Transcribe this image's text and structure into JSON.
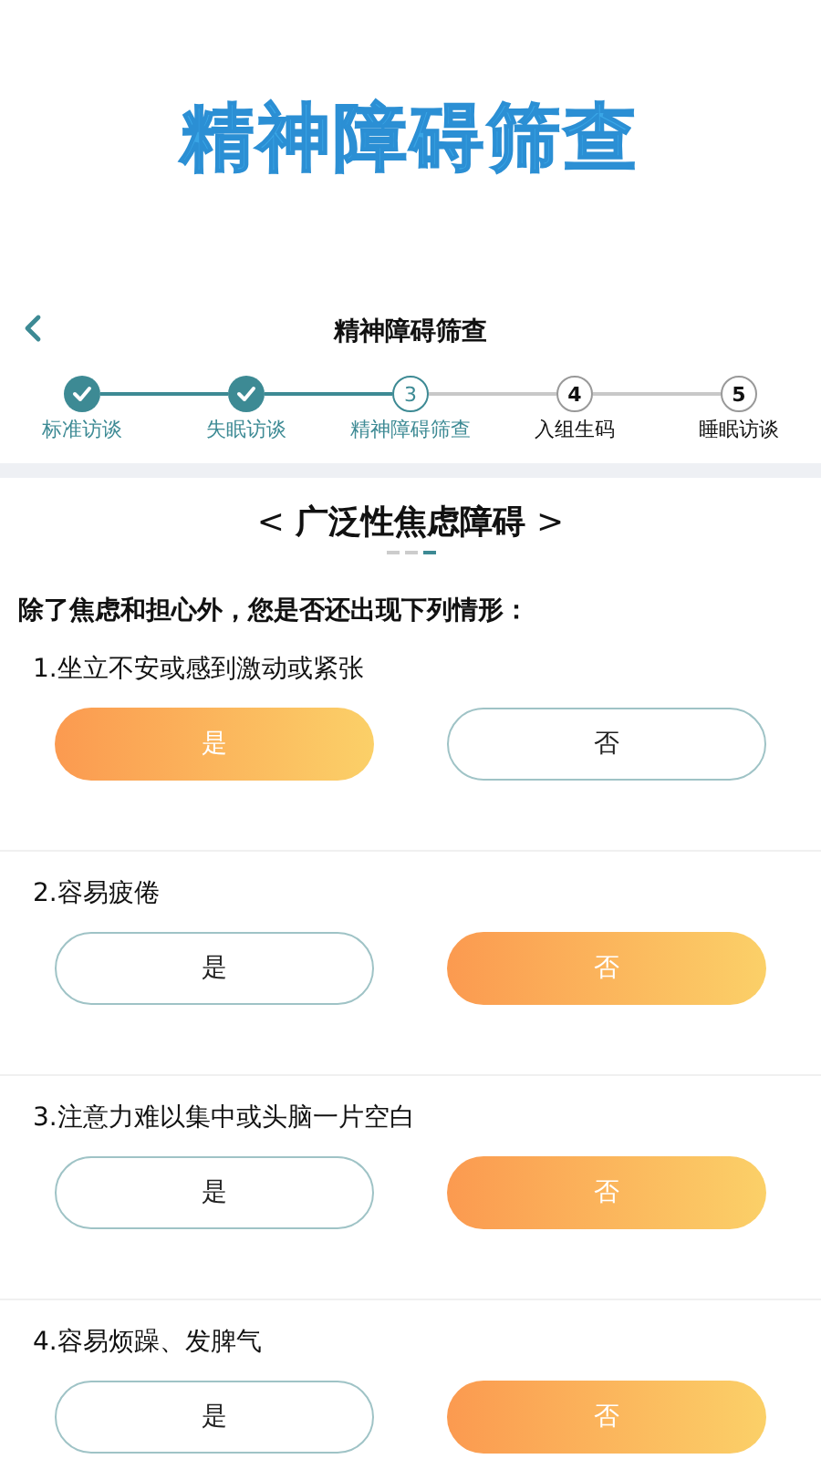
{
  "banner": {
    "title": "精神障碍筛查"
  },
  "header": {
    "title": "精神障碍筛查"
  },
  "steps": [
    {
      "label": "标准访谈",
      "done": true,
      "selected": false
    },
    {
      "label": "失眠访谈",
      "done": true,
      "selected": false
    },
    {
      "label": "精神障碍筛查",
      "number": "3",
      "done": false,
      "selected": true
    },
    {
      "label": "入组生码",
      "number": "4",
      "done": false,
      "selected": false
    },
    {
      "label": "睡眠访谈",
      "number": "5",
      "done": false,
      "selected": false
    }
  ],
  "section": {
    "title": "广泛性焦虑障碍",
    "prev": "<",
    "next": ">"
  },
  "page_dots": [
    {
      "selected": false
    },
    {
      "selected": false
    },
    {
      "selected": true
    }
  ],
  "prompt": "除了焦虑和担心外，您是否还出现下列情形：",
  "questions": [
    {
      "text": "1.坐立不安或感到激动或紧张",
      "options": [
        {
          "label": "是",
          "selected": true
        },
        {
          "label": "否",
          "selected": false
        }
      ]
    },
    {
      "text": "2.容易疲倦",
      "options": [
        {
          "label": "是",
          "selected": false
        },
        {
          "label": "否",
          "selected": true
        }
      ]
    },
    {
      "text": "3.注意力难以集中或头脑一片空白",
      "options": [
        {
          "label": "是",
          "selected": false
        },
        {
          "label": "否",
          "selected": true
        }
      ]
    },
    {
      "text": "4.容易烦躁、发脾气",
      "options": [
        {
          "label": "是",
          "selected": false
        },
        {
          "label": "否",
          "selected": true
        }
      ]
    }
  ]
}
